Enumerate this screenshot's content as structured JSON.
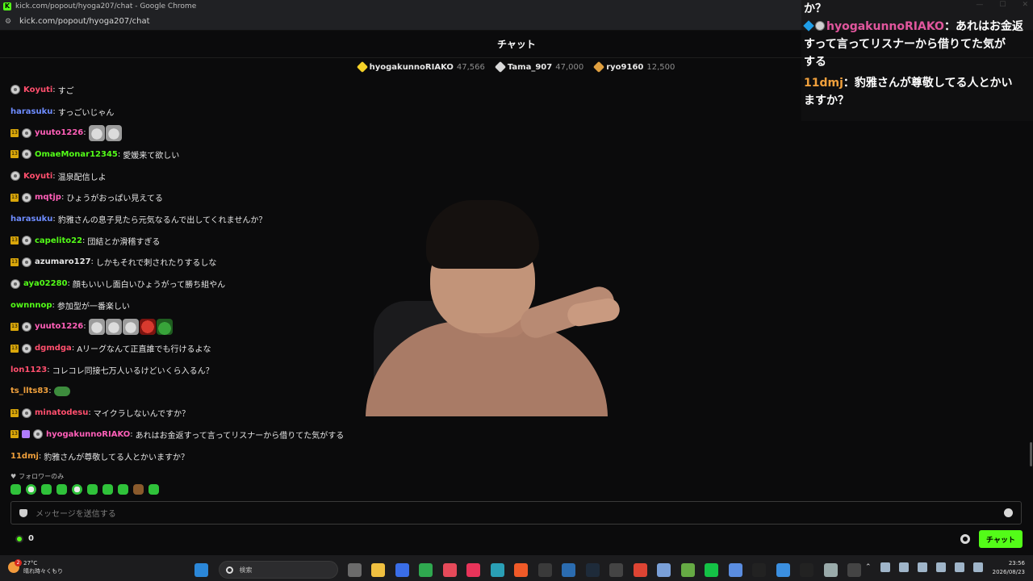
{
  "browser": {
    "window_title": "kick.com/popout/hyoga207/chat - Google Chrome",
    "url": "kick.com/popout/hyoga207/chat",
    "favicon_letter": "K"
  },
  "chat": {
    "title": "チャット",
    "leaderboard": [
      {
        "name": "hyogakunnoRIAKO",
        "amount": "47,566",
        "color": "#f5d128"
      },
      {
        "name": "Tama_907",
        "amount": "47,000",
        "color": "#d8d8d8"
      },
      {
        "name": "ryo9160",
        "amount": "12,500",
        "color": "#e0a040"
      }
    ],
    "messages": [
      {
        "badges": [
          "av"
        ],
        "user": "Koyuti",
        "color": "#ff4f6d",
        "text": "すご",
        "emotes": []
      },
      {
        "badges": [],
        "user": "harasuku",
        "color": "#6e8cff",
        "text": "すっごいじゃん",
        "emotes": []
      },
      {
        "badges": [
          "sub",
          "av"
        ],
        "user": "yuuto1226",
        "color": "#ff5fb8",
        "text": "",
        "emotes": [
          "cat",
          "cat"
        ]
      },
      {
        "badges": [
          "sub",
          "av"
        ],
        "user": "OmaeMonar12345",
        "color": "#53fc18",
        "text": "愛媛来て欲しい",
        "emotes": []
      },
      {
        "badges": [
          "av"
        ],
        "user": "Koyuti",
        "color": "#ff4f6d",
        "text": "温泉配信しよ",
        "emotes": []
      },
      {
        "badges": [
          "sub",
          "av"
        ],
        "user": "mqtjp",
        "color": "#ff5fb8",
        "text": "ひょうがおっぱい見えてる",
        "emotes": []
      },
      {
        "badges": [],
        "user": "harasuku",
        "color": "#6e8cff",
        "text": "豹雅さんの息子見たら元気なるんで出してくれませんか？",
        "emotes": []
      },
      {
        "badges": [
          "sub",
          "av"
        ],
        "user": "capelito22",
        "color": "#53fc18",
        "text": "団結とか滑稽すぎる",
        "emotes": []
      },
      {
        "badges": [
          "sub",
          "av"
        ],
        "user": "azumaro127",
        "color": "#e6e6e6",
        "text": "しかもそれで刺されたりするしな",
        "emotes": []
      },
      {
        "badges": [
          "av"
        ],
        "user": "aya02280",
        "color": "#53fc18",
        "text": "顔もいいし面白いひょうがって勝ち組やん",
        "emotes": []
      },
      {
        "badges": [],
        "user": "ownnnop",
        "color": "#53fc18",
        "text": "参加型が一番楽しい",
        "emotes": []
      },
      {
        "badges": [
          "sub",
          "av"
        ],
        "user": "yuuto1226",
        "color": "#ff5fb8",
        "text": "",
        "emotes": [
          "cat",
          "cat",
          "cat",
          "red",
          "frog"
        ]
      },
      {
        "badges": [
          "sub",
          "av"
        ],
        "user": "dgmdga",
        "color": "#ff4f6d",
        "text": "Aリーグなんて正直誰でも行けるよな",
        "emotes": []
      },
      {
        "badges": [],
        "user": "lon1123",
        "color": "#ff4f6d",
        "text": "コレコレ同接七万人いるけどいくら入るん？",
        "emotes": []
      },
      {
        "badges": [],
        "user": "ts_llts83",
        "color": "#f0a03c",
        "text": "",
        "emotes": [
          "pepe"
        ]
      },
      {
        "badges": [
          "sub",
          "av"
        ],
        "user": "minatodesu",
        "color": "#ff4f6d",
        "text": "マイクラしないんですか？",
        "emotes": []
      },
      {
        "badges": [
          "sub",
          "gift",
          "av"
        ],
        "user": "hyogakunnoRIAKO",
        "color": "#ff5fb8",
        "text": "あれはお金返すって言ってリスナーから借りてた気がする",
        "emotes": []
      },
      {
        "badges": [],
        "user": "11dmj",
        "color": "#f0a03c",
        "text": "豹雅さんが尊敬してる人とかいますか？",
        "emotes": []
      }
    ],
    "followers_only": "フォロワーのみ",
    "input_placeholder": "メッセージを送信する",
    "points": "0",
    "send_label": "チャット"
  },
  "overlay": {
    "line0": "か？",
    "msg1_user": "hyogakunnoRIAKO",
    "msg1_text_a": "：あれはお金返",
    "msg1_text_b": "すって言ってリスナーから借りてた気が",
    "msg1_text_c": "する",
    "msg2_user": "11dmj",
    "msg2_text_a": "：豹雅さんが尊敬してる人とかい",
    "msg2_text_b": "ますか？"
  },
  "taskbar": {
    "weather_temp": "27°C",
    "weather_desc": "晴れ時々くもり",
    "notif_count": "2",
    "search_placeholder": "検索",
    "time": "23:56",
    "date": "2026/08/23",
    "apps": [
      "#2b87d8",
      "#6b6b6b",
      "#f0c040",
      "#3a6ee8",
      "#2fa84f",
      "#e64a5a",
      "#e8345a",
      "#2a9fb5",
      "#f05a28",
      "#3a3a3a",
      "#2b6cb0",
      "#1e2b3a",
      "#444",
      "#d43",
      "#7aa0d8",
      "#6a4",
      "#14c246",
      "#5a8de0",
      "#222",
      "#3b8fe0",
      "#222",
      "#9aa",
      "#444"
    ]
  }
}
